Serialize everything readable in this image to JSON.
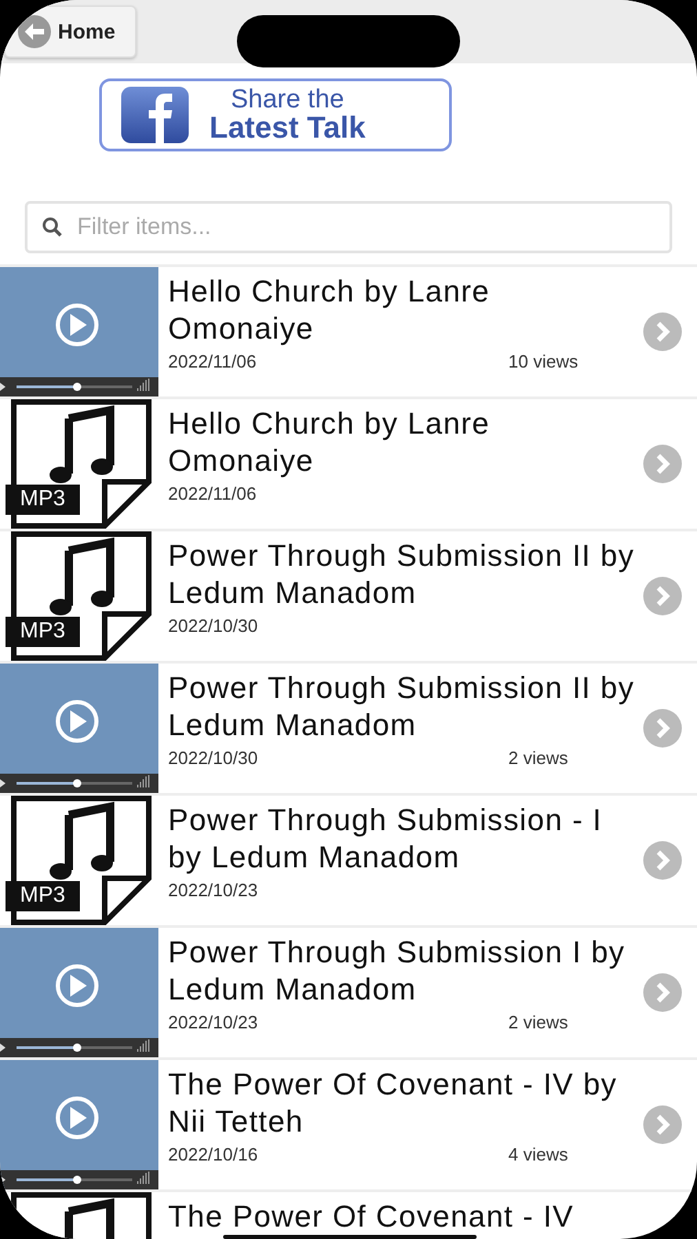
{
  "header": {
    "back_button": "Home"
  },
  "share_button": {
    "line_1": "Share the",
    "line_2": "Latest Talk"
  },
  "search": {
    "placeholder": "Filter items..."
  },
  "items": [
    {
      "kind": "video",
      "title": "Hello Church by Lanre Omonaiye",
      "date": "2022/11/06",
      "views": "10 views"
    },
    {
      "kind": "mp3",
      "badge": "MP3",
      "title": "Hello Church by Lanre Omonaiye",
      "date": "2022/11/06"
    },
    {
      "kind": "mp3",
      "badge": "MP3",
      "title": "Power Through Submission II by Ledum Manadom",
      "date": "2022/10/30"
    },
    {
      "kind": "video",
      "title": "Power Through Submission II by Ledum Manadom",
      "date": "2022/10/30",
      "views": "2 views"
    },
    {
      "kind": "mp3",
      "badge": "MP3",
      "title": "Power Through Submission - I by Ledum Manadom",
      "date": "2022/10/23"
    },
    {
      "kind": "video",
      "title": "Power Through Submission I by Ledum Manadom",
      "date": "2022/10/23",
      "views": "2 views"
    },
    {
      "kind": "video",
      "title": "The Power Of Covenant - IV by Nii Tetteh",
      "date": "2022/10/16",
      "views": "4 views"
    },
    {
      "kind": "mp3",
      "title": "The Power Of Covenant - IV"
    }
  ]
}
